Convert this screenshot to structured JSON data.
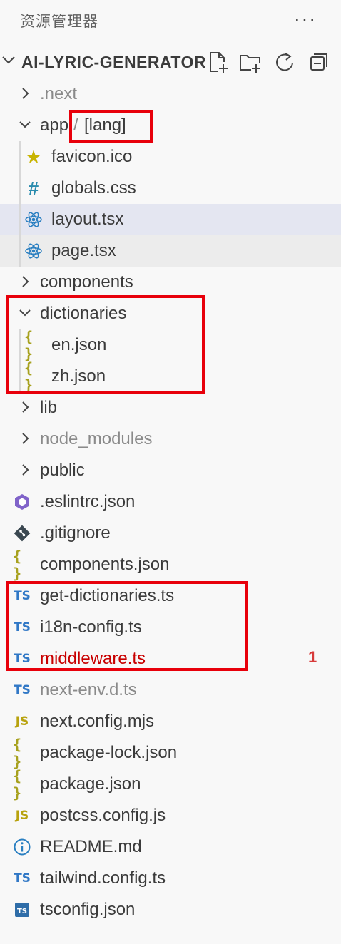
{
  "panel": {
    "title": "资源管理器",
    "more_icon": "more-icon"
  },
  "project": {
    "name": "AI-LYRIC-GENERATOR",
    "actions": [
      "new-file-icon",
      "new-folder-icon",
      "refresh-icon",
      "collapse-all-icon"
    ]
  },
  "tree": [
    {
      "label": ".next",
      "type": "folder",
      "state": "collapsed",
      "muted": true
    },
    {
      "label": "app",
      "type": "folder",
      "state": "expanded",
      "sep": "/",
      "suffix": "[lang]"
    },
    {
      "label": "favicon.ico",
      "type": "file",
      "icon": "star-icon"
    },
    {
      "label": "globals.css",
      "type": "file",
      "icon": "hash-icon"
    },
    {
      "label": "layout.tsx",
      "type": "file",
      "icon": "react-icon",
      "selected": true
    },
    {
      "label": "page.tsx",
      "type": "file",
      "icon": "react-icon",
      "hover": true
    },
    {
      "label": "components",
      "type": "folder",
      "state": "collapsed"
    },
    {
      "label": "dictionaries",
      "type": "folder",
      "state": "expanded"
    },
    {
      "label": "en.json",
      "type": "file",
      "icon": "json-icon",
      "icon_text": "{ }"
    },
    {
      "label": "zh.json",
      "type": "file",
      "icon": "json-icon",
      "icon_text": "{ }"
    },
    {
      "label": "lib",
      "type": "folder",
      "state": "collapsed"
    },
    {
      "label": "node_modules",
      "type": "folder",
      "state": "collapsed",
      "muted": true
    },
    {
      "label": "public",
      "type": "folder",
      "state": "collapsed"
    },
    {
      "label": ".eslintrc.json",
      "type": "file",
      "icon": "eslint-icon"
    },
    {
      "label": ".gitignore",
      "type": "file",
      "icon": "git-icon"
    },
    {
      "label": "components.json",
      "type": "file",
      "icon": "json-icon",
      "icon_text": "{ }"
    },
    {
      "label": "get-dictionaries.ts",
      "type": "file",
      "icon": "ts-icon",
      "icon_text": "TS"
    },
    {
      "label": "i18n-config.ts",
      "type": "file",
      "icon": "ts-icon",
      "icon_text": "TS"
    },
    {
      "label": "middleware.ts",
      "type": "file",
      "icon": "ts-icon",
      "icon_text": "TS",
      "error": true,
      "badge": "1"
    },
    {
      "label": "next-env.d.ts",
      "type": "file",
      "icon": "ts-icon",
      "icon_text": "TS",
      "muted": true
    },
    {
      "label": "next.config.mjs",
      "type": "file",
      "icon": "js-icon",
      "icon_text": "JS"
    },
    {
      "label": "package-lock.json",
      "type": "file",
      "icon": "json-icon",
      "icon_text": "{ }"
    },
    {
      "label": "package.json",
      "type": "file",
      "icon": "json-icon",
      "icon_text": "{ }"
    },
    {
      "label": "postcss.config.js",
      "type": "file",
      "icon": "js-icon",
      "icon_text": "JS"
    },
    {
      "label": "README.md",
      "type": "file",
      "icon": "info-icon"
    },
    {
      "label": "tailwind.config.ts",
      "type": "file",
      "icon": "ts-icon",
      "icon_text": "TS"
    },
    {
      "label": "tsconfig.json",
      "type": "file",
      "icon": "tsconfig-icon",
      "icon_text": "TS"
    }
  ],
  "colors": {
    "highlight": "#e8000b",
    "selected_bg": "#e4e6f1",
    "hover_bg": "#ececec",
    "error": "#c80000"
  }
}
